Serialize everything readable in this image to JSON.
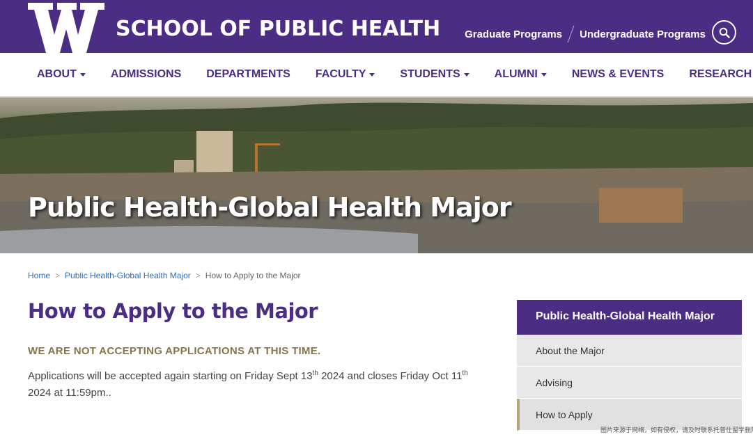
{
  "header": {
    "school_name": "SCHOOL OF PUBLIC HEALTH",
    "logo_letter": "W",
    "links": [
      "Graduate Programs",
      "Undergraduate Programs"
    ],
    "search_icon": "search-icon",
    "brand_color": "#4b2e83"
  },
  "nav": {
    "items": [
      {
        "label": "ABOUT",
        "dropdown": true
      },
      {
        "label": "ADMISSIONS",
        "dropdown": false
      },
      {
        "label": "DEPARTMENTS",
        "dropdown": false
      },
      {
        "label": "FACULTY",
        "dropdown": true
      },
      {
        "label": "STUDENTS",
        "dropdown": true
      },
      {
        "label": "ALUMNI",
        "dropdown": true
      },
      {
        "label": "NEWS & EVENTS",
        "dropdown": false
      },
      {
        "label": "RESEARCH",
        "dropdown": false
      }
    ]
  },
  "hero": {
    "title": "Public Health-Global Health Major"
  },
  "breadcrumb": {
    "items": [
      "Home",
      "Public Health-Global Health Major",
      "How to Apply to the Major"
    ],
    "separator": ">"
  },
  "content": {
    "title": "How to Apply to the Major",
    "notice": "WE ARE NOT ACCEPTING APPLICATIONS AT THIS TIME.",
    "body": {
      "part1": "Applications will be accepted again starting on Friday Sept 13",
      "sup1": "th",
      "part2": " 2024 and closes Friday Oct 11",
      "sup2": "th",
      "part3": " 2024 at 11:59pm.."
    }
  },
  "sidebar": {
    "heading": "Public Health-Global Health Major",
    "items": [
      {
        "label": "About the Major",
        "active": false
      },
      {
        "label": "Advising",
        "active": false
      },
      {
        "label": "How to Apply",
        "active": true
      }
    ]
  },
  "watermark": "图片来源于网络，如有侵权，请及时联系托普仕留学删除"
}
